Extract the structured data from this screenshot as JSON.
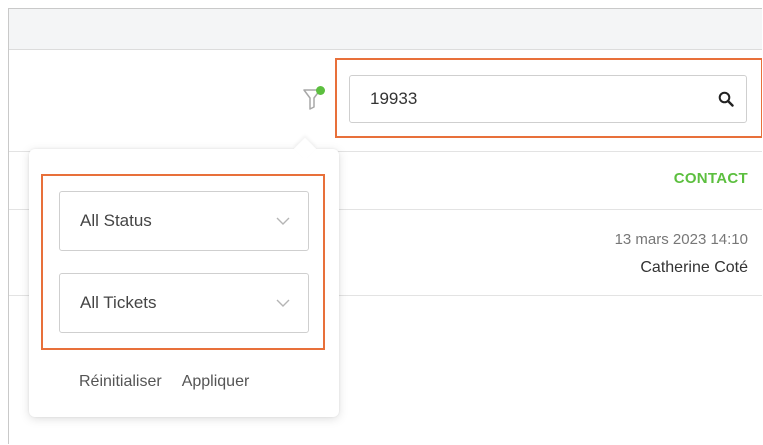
{
  "search": {
    "value": "19933",
    "icon": "search-icon"
  },
  "filter": {
    "icon": "filter-icon",
    "active_indicator_color": "#5cbf3f"
  },
  "table": {
    "column_header": "CONTACT",
    "rows": [
      {
        "date": "13 mars 2023 14:10",
        "contact": "Catherine Coté"
      }
    ]
  },
  "filter_popover": {
    "status_select": "All Status",
    "tickets_select": "All Tickets",
    "reset_label": "Réinitialiser",
    "apply_label": "Appliquer"
  },
  "colors": {
    "accent_green": "#5cbf3f",
    "highlight_orange": "#e8703a"
  }
}
